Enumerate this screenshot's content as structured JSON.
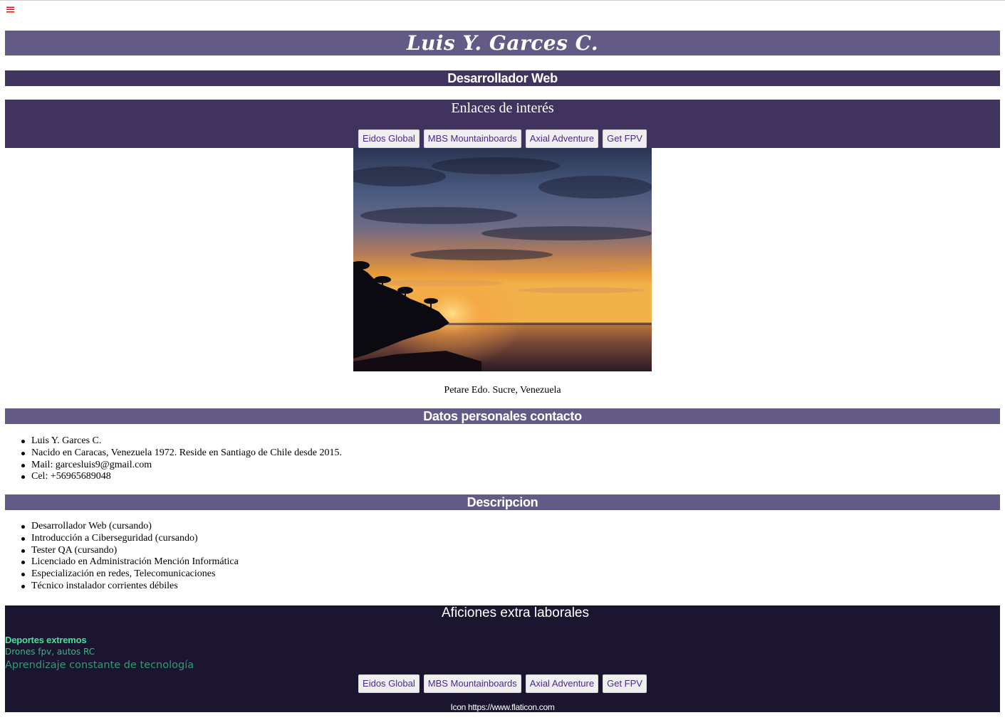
{
  "menu": {
    "icon": "hamburger-menu-icon",
    "glyph": "≡"
  },
  "header": {
    "name": "Luis Y. Garces C.",
    "role": "Desarrollador Web"
  },
  "links": {
    "title": "Enlaces de interés",
    "items": [
      "Eidos Global",
      "MBS Mountainboards",
      "Axial Adventure",
      "Get FPV"
    ]
  },
  "photo": {
    "caption": "Petare Edo. Sucre, Venezuela"
  },
  "datos": {
    "title": "Datos personales contacto",
    "items": [
      "Luis Y. Garces C.",
      "Nacido en Caracas, Venezuela 1972. Reside en Santiago de Chile desde 2015.",
      "Mail: garcesluis9@gmail.com",
      "Cel: +56965689048"
    ]
  },
  "descripcion": {
    "title": "Descripcion",
    "items": [
      "Desarrollador Web (cursando)",
      "Introducción a Ciberseguridad (cursando)",
      "Tester QA (cursando)",
      "Licenciado en Administración Mención Informática",
      "Especialización en redes, Telecomunicaciones",
      "Técnico instalador corrientes débiles"
    ]
  },
  "footer": {
    "title": "Aficiones extra laborales",
    "sport": "Deportes extremos",
    "hobbies": "Drones fpv, autos RC",
    "learning": "Aprendizaje constante de tecnología",
    "links": [
      "Eidos Global",
      "MBS Mountainboards",
      "Axial Adventure",
      "Get FPV"
    ],
    "credit": "Icon https://www.flaticon.com"
  },
  "colors": {
    "band_light": "#645a86",
    "band_dark": "#40345e",
    "footer_bg": "#1c1530",
    "menu_icon": "#dd1111",
    "green_text": "#43e39a"
  }
}
